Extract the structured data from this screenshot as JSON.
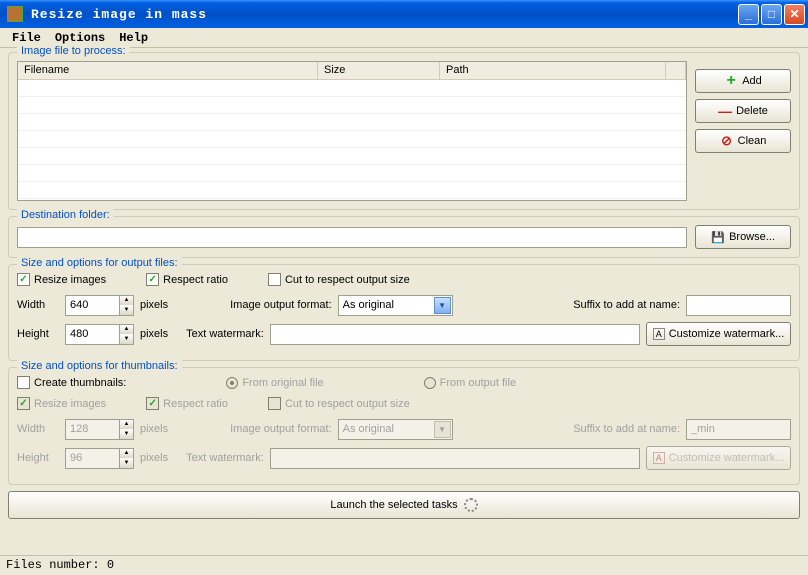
{
  "window": {
    "title": "Resize image in mass"
  },
  "menubar": {
    "file": "File",
    "options": "Options",
    "help": "Help"
  },
  "group_files": {
    "legend": "Image file to process:",
    "col_filename": "Filename",
    "col_size": "Size",
    "col_path": "Path"
  },
  "buttons": {
    "add": "Add",
    "delete": "Delete",
    "clean": "Clean",
    "browse": "Browse...",
    "customize_watermark": "Customize watermark...",
    "launch": "Launch the selected tasks"
  },
  "group_dest": {
    "legend": "Destination folder:",
    "value": ""
  },
  "group_output": {
    "legend": "Size and options for output files:",
    "resize_images": "Resize images",
    "respect_ratio": "Respect ratio",
    "cut_respect": "Cut to respect output size",
    "width_label": "Width",
    "width_value": "640",
    "height_label": "Height",
    "height_value": "480",
    "pixels": "pixels",
    "format_label": "Image output format:",
    "format_value": "As original",
    "suffix_label": "Suffix to add at name:",
    "suffix_value": "",
    "watermark_label": "Text watermark:",
    "watermark_value": ""
  },
  "group_thumbs": {
    "legend": "Size and options for thumbnails:",
    "create": "Create thumbnails:",
    "from_original": "From original file",
    "from_output": "From output file",
    "resize_images": "Resize images",
    "respect_ratio": "Respect ratio",
    "cut_respect": "Cut to respect output size",
    "width_label": "Width",
    "width_value": "128",
    "height_label": "Height",
    "height_value": "96",
    "pixels": "pixels",
    "format_label": "Image output format:",
    "format_value": "As original",
    "suffix_label": "Suffix to add at name:",
    "suffix_value": "_min",
    "watermark_label": "Text watermark:",
    "watermark_value": ""
  },
  "statusbar": {
    "text": "Files number: 0"
  }
}
